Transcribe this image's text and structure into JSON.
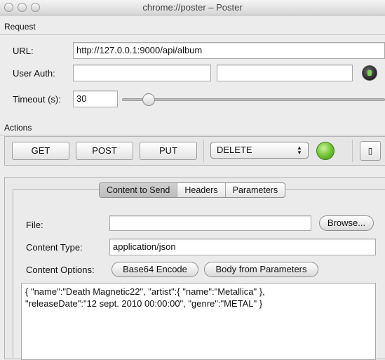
{
  "window": {
    "title": "chrome://poster – Poster"
  },
  "request": {
    "section_label": "Request",
    "url_label": "URL:",
    "url_value": "http://127.0.0.1:9000/api/album",
    "user_auth_label": "User Auth:",
    "user_value": "",
    "password_value": "",
    "timeout_label": "Timeout (s):",
    "timeout_value": "30"
  },
  "actions": {
    "section_label": "Actions",
    "get_label": "GET",
    "post_label": "POST",
    "put_label": "PUT",
    "method_selected": "DELETE",
    "side_button_label": "▯",
    "status_color": "#6cc131"
  },
  "tabs": [
    {
      "label": "Content to Send",
      "active": true
    },
    {
      "label": "Headers",
      "active": false
    },
    {
      "label": "Parameters",
      "active": false
    }
  ],
  "content": {
    "file_label": "File:",
    "file_value": "",
    "browse_label": "Browse...",
    "content_type_label": "Content Type:",
    "content_type_value": "application/json",
    "content_options_label": "Content Options:",
    "base64_label": "Base64 Encode",
    "body_from_params_label": "Body from Parameters",
    "body_text": "{ \"name\":\"Death Magnetic22\", \"artist\":{ \"name\":\"Metallica\" },\n\"releaseDate\":\"12 sept. 2010 00:00:00\", \"genre\":\"METAL\" }"
  }
}
